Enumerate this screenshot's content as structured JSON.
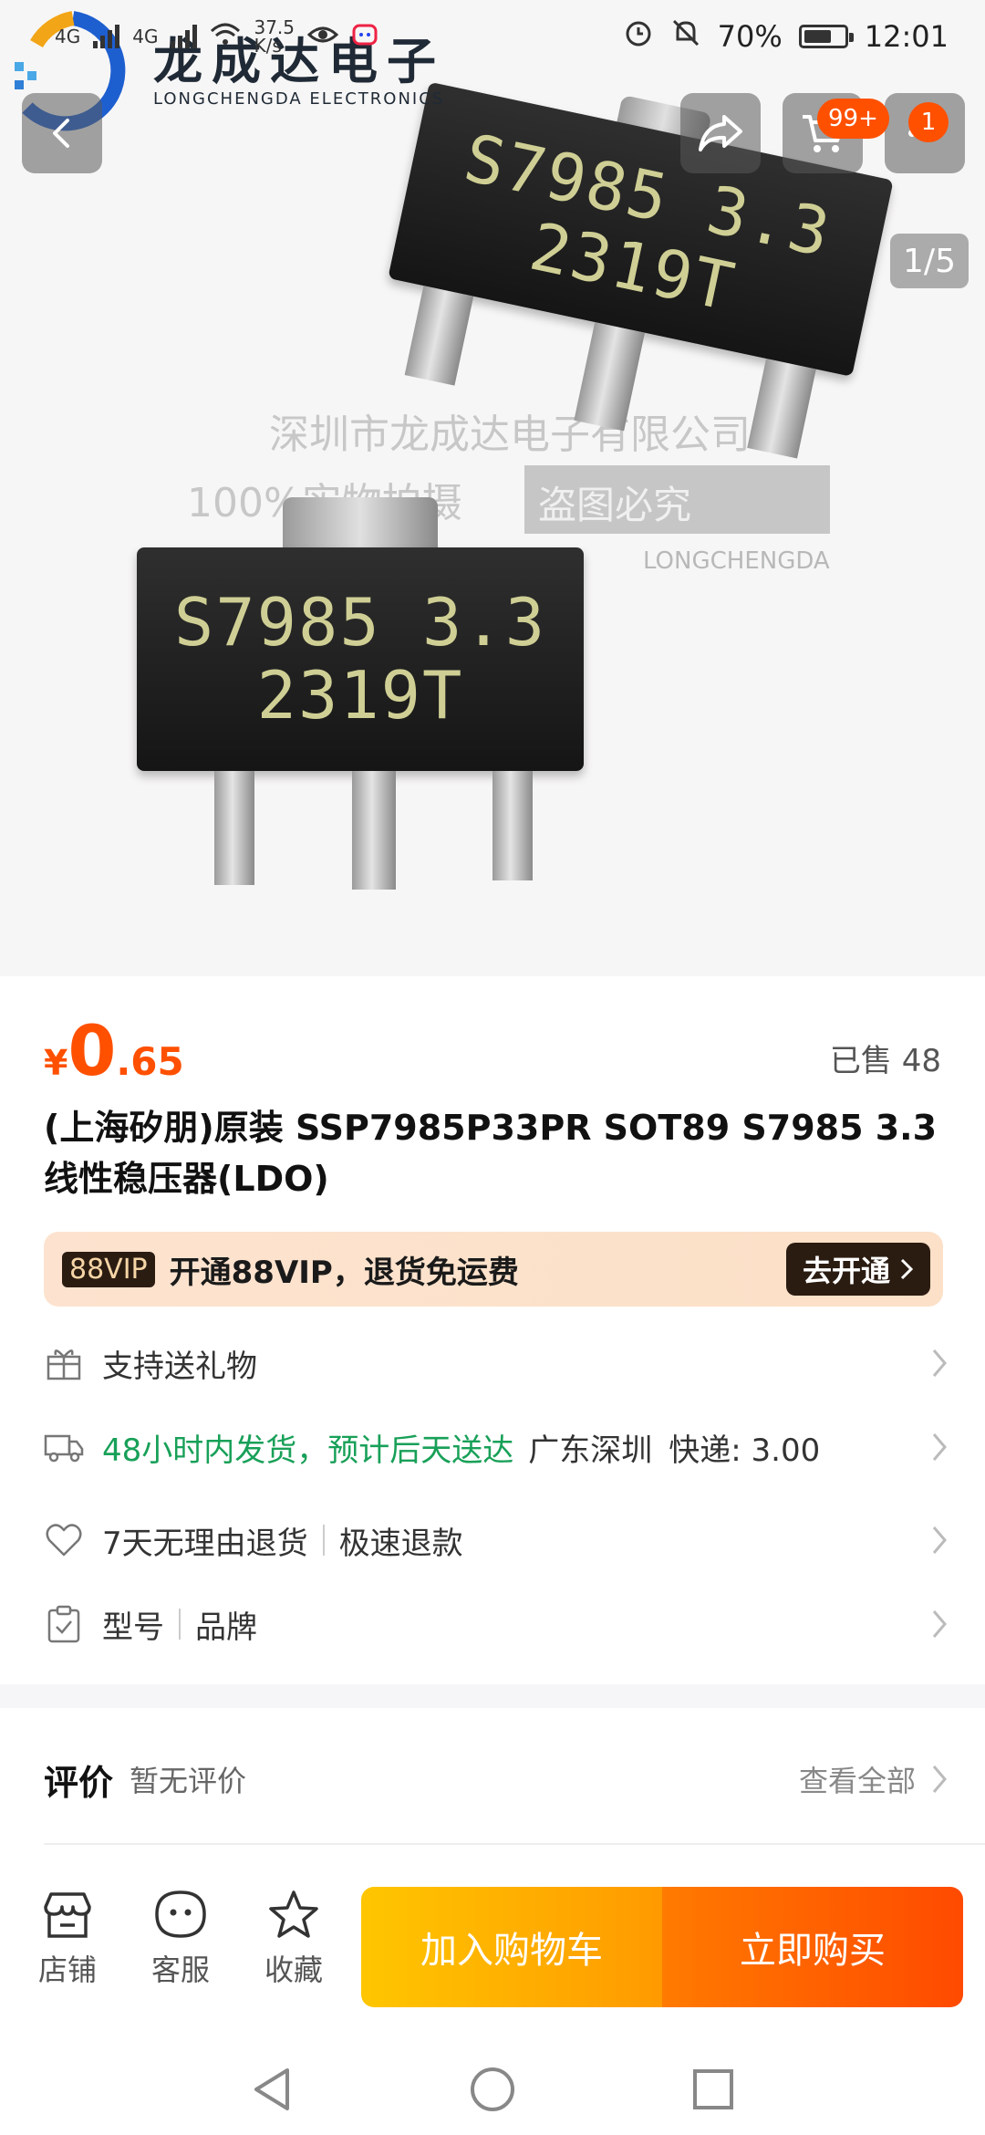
{
  "status_bar": {
    "network_left": "4G",
    "network_right": "4G",
    "speed": "37.5",
    "speed_unit": "K/s",
    "battery": "70%",
    "battery_level": 0.7,
    "time": "12:01"
  },
  "brand": {
    "name_cn": "龙成达电子",
    "name_en": "LONGCHENGDA ELECTRONICS"
  },
  "hero": {
    "chip_line1": "S7985 3.3",
    "chip_line2": "2319T",
    "watermark1": "深圳市龙成达电子有限公司",
    "watermark2": "100%实物拍摄",
    "watermark3": "盗图必究",
    "watermark4": "LONGCHENGDA",
    "image_counter": "1/5"
  },
  "header": {
    "cart_badge": "99+",
    "more_badge": "1"
  },
  "price": {
    "currency": "¥",
    "integer": "0",
    "decimal": ".65",
    "sold": "已售 48"
  },
  "product_title": "(上海矽朋)原装 SSP7985P33PR SOT89 S7985 3.3 线性稳压器(LDO)",
  "vip": {
    "tag": "88VIP",
    "text": "开通88VIP，退货免运费",
    "button": "去开通"
  },
  "services": {
    "gift": "支持送礼物",
    "shipping_promise": "48小时内发货，预计后天送达",
    "origin": "广东深圳",
    "shipping_fee": "快递: 3.00",
    "return_policy": "7天无理由退货",
    "refund": "极速退款",
    "spec_model": "型号",
    "spec_brand": "品牌"
  },
  "reviews": {
    "heading": "评价",
    "empty": "暂无评价",
    "view_all": "查看全部"
  },
  "bottom_bar": {
    "shop": "店铺",
    "service": "客服",
    "favorite": "收藏",
    "add_to_cart": "加入购物车",
    "buy_now": "立即购买"
  },
  "colors": {
    "accent": "#ff5000",
    "cart_button": "#ffb300",
    "buy_button": "#ff5a00",
    "shipping_green": "#18a058"
  }
}
